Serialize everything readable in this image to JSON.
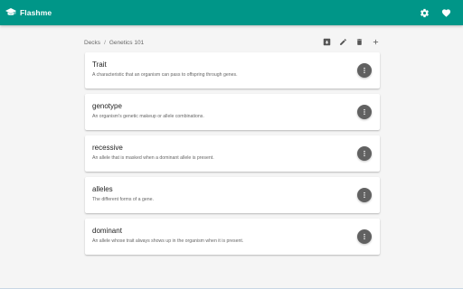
{
  "app": {
    "title": "Flashme",
    "brand_color": "#009688",
    "icons": {
      "logo": "graduation-cap-icon",
      "settings": "gear-icon",
      "favorite": "heart-icon"
    }
  },
  "breadcrumb": {
    "root": "Decks",
    "separator": "/",
    "current": "Genetics 101"
  },
  "deck_actions": {
    "icons": [
      "download-box-icon",
      "pencil-icon",
      "trash-icon",
      "plus-icon"
    ]
  },
  "cards": [
    {
      "term": "Trait",
      "definition": "A characteristic that an organism can pass to offspring through genes."
    },
    {
      "term": "genotype",
      "definition": "An organism's genetic makeup or allele combinations."
    },
    {
      "term": "recessive",
      "definition": "An allele that is masked when a dominant allele is present."
    },
    {
      "term": "alleles",
      "definition": "The different forms of a gene."
    },
    {
      "term": "dominant",
      "definition": "An allele whose trait always shows up in the organism when it is present."
    }
  ]
}
